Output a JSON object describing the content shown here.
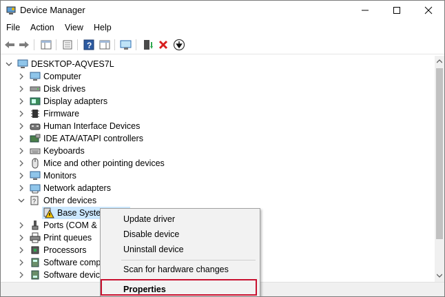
{
  "window": {
    "title": "Device Manager",
    "controls": {
      "minimize": "—",
      "maximize": "☐",
      "close": "✕"
    }
  },
  "menu": [
    "File",
    "Action",
    "View",
    "Help"
  ],
  "toolbar": {
    "icons": [
      "back-icon",
      "forward-icon",
      "show-hide-console-tree-icon",
      "properties-icon",
      "help-icon",
      "action-pane-icon",
      "scan-hardware-icon",
      "update-driver-icon",
      "uninstall-device-icon",
      "disable-device-icon"
    ]
  },
  "tree": {
    "root": "DESKTOP-AQVES7L",
    "categories": [
      {
        "label": "Computer",
        "icon": "computer-icon"
      },
      {
        "label": "Disk drives",
        "icon": "disk-drive-icon"
      },
      {
        "label": "Display adapters",
        "icon": "display-adapter-icon"
      },
      {
        "label": "Firmware",
        "icon": "firmware-icon"
      },
      {
        "label": "Human Interface Devices",
        "icon": "hid-icon"
      },
      {
        "label": "IDE ATA/ATAPI controllers",
        "icon": "ide-controller-icon"
      },
      {
        "label": "Keyboards",
        "icon": "keyboard-icon"
      },
      {
        "label": "Mice and other pointing devices",
        "icon": "mouse-icon"
      },
      {
        "label": "Monitors",
        "icon": "monitor-icon"
      },
      {
        "label": "Network adapters",
        "icon": "network-adapter-icon"
      },
      {
        "label": "Other devices",
        "icon": "unknown-device-icon",
        "expanded": true
      },
      {
        "label": "Ports (COM & L",
        "icon": "port-icon"
      },
      {
        "label": "Print queues",
        "icon": "printer-icon"
      },
      {
        "label": "Processors",
        "icon": "processor-icon"
      },
      {
        "label": "Software comp",
        "icon": "software-component-icon"
      },
      {
        "label": "Software device",
        "icon": "software-device-icon"
      }
    ],
    "child": {
      "label": "Base System",
      "icon": "warning-device-icon"
    }
  },
  "context_menu": {
    "items": [
      "Update driver",
      "Disable device",
      "Uninstall device",
      "Scan for hardware changes",
      "Properties"
    ]
  },
  "colors": {
    "selection": "#cce8ff",
    "highlight_border": "#c8102e",
    "menu_bg": "#f2f2f2"
  }
}
